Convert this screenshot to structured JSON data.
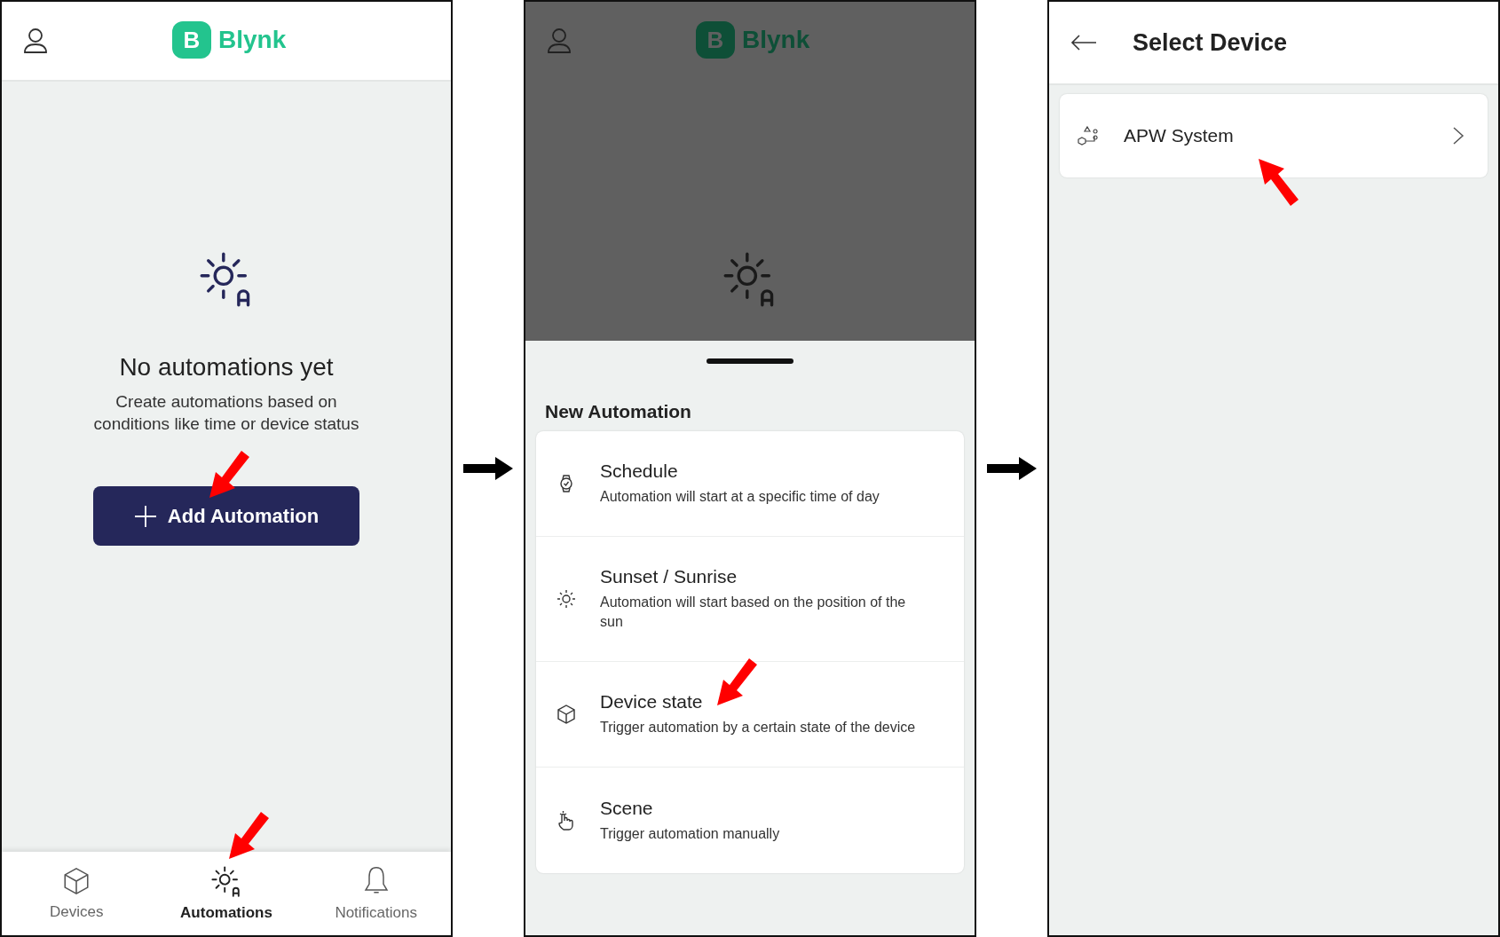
{
  "screens": [
    {
      "kind": "empty_state",
      "logo": {
        "mark": "B",
        "name": "Blynk"
      },
      "title": "No automations yet",
      "description": "Create automations based on conditions like time or device status",
      "button": {
        "label": "Add Automation"
      },
      "nav": [
        {
          "kind": "devices",
          "label": "Devices",
          "selected": false
        },
        {
          "kind": "automations",
          "label": "Automations",
          "selected": true
        },
        {
          "kind": "notifications",
          "label": "Notifications",
          "selected": false
        }
      ]
    },
    {
      "kind": "sheet",
      "logo": {
        "mark": "B",
        "name": "Blynk"
      },
      "sheet_title": "New Automation",
      "options": [
        {
          "kind": "schedule",
          "title": "Schedule",
          "description": "Automation will start at a specific time of day"
        },
        {
          "kind": "sun",
          "title": "Sunset / Sunrise",
          "description": "Automation will start based on the position of the sun"
        },
        {
          "kind": "device",
          "title": "Device state",
          "description": "Trigger automation by a certain state of the device"
        },
        {
          "kind": "scene",
          "title": "Scene",
          "description": "Trigger automation manually"
        }
      ]
    },
    {
      "kind": "select",
      "title": "Select Device",
      "devices": [
        {
          "name": "APW System"
        }
      ]
    }
  ]
}
